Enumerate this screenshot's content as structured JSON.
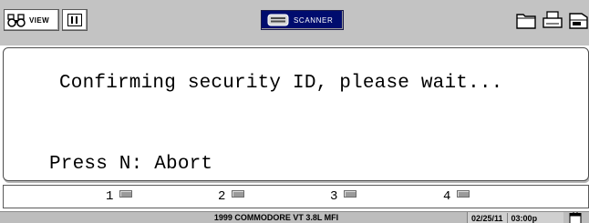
{
  "toolbar": {
    "view_label": "VIEW",
    "scanner_label": "SCANNER",
    "icons": {
      "view": "binoculars-icon",
      "pause": "pause-icon",
      "scanner": "keyboard-icon",
      "folder": "folder-icon",
      "print": "printer-icon",
      "disk": "disk-icon"
    },
    "colors": {
      "scanner_bg": "#000c6e",
      "toolbar_bg": "#c3c3c3"
    }
  },
  "message": {
    "text": "Confirming security ID, please wait...",
    "prompt": "Press N: Abort"
  },
  "softkeys": [
    {
      "label": "1"
    },
    {
      "label": "2"
    },
    {
      "label": "3"
    },
    {
      "label": "4"
    }
  ],
  "status": {
    "vehicle": "1999  COMMODORE VT 3.8L MFI",
    "date": "02/25/11",
    "time": "03:00p",
    "icon": "calendar-icon"
  }
}
